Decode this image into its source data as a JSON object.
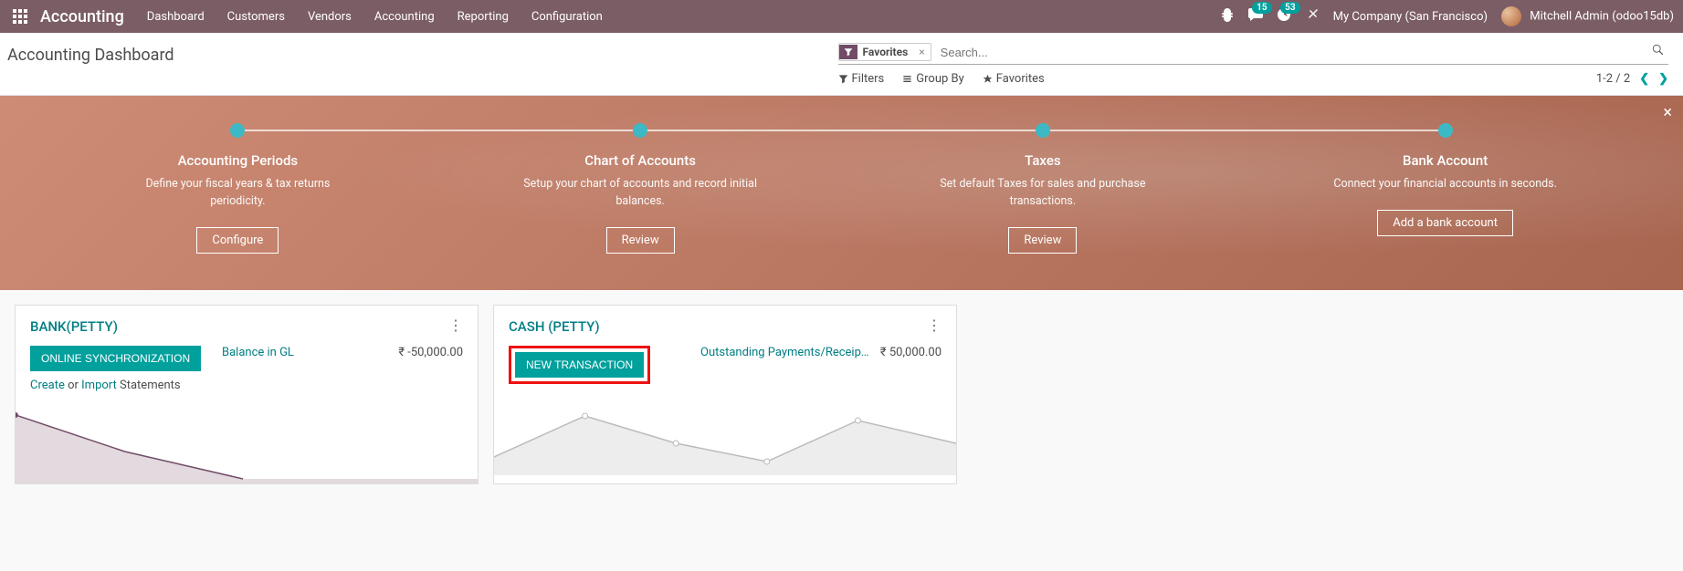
{
  "topnav": {
    "brand": "Accounting",
    "menu": [
      "Dashboard",
      "Customers",
      "Vendors",
      "Accounting",
      "Reporting",
      "Configuration"
    ],
    "messages_count": "15",
    "activities_count": "53",
    "company": "My Company (San Francisco)",
    "user": "Mitchell Admin (odoo15db)"
  },
  "breadcrumb": {
    "title": "Accounting Dashboard"
  },
  "search": {
    "facet_label": "Favorites",
    "placeholder": "Search...",
    "filters_label": "Filters",
    "groupby_label": "Group By",
    "favorites_label": "Favorites",
    "pager": "1-2 / 2"
  },
  "onboarding": {
    "steps": [
      {
        "title": "Accounting Periods",
        "desc": "Define your fiscal years & tax returns periodicity.",
        "btn": "Configure"
      },
      {
        "title": "Chart of Accounts",
        "desc": "Setup your chart of accounts and record initial balances.",
        "btn": "Review"
      },
      {
        "title": "Taxes",
        "desc": "Set default Taxes for sales and purchase transactions.",
        "btn": "Review"
      },
      {
        "title": "Bank Account",
        "desc": "Connect your financial accounts in seconds.",
        "btn": "Add a bank account"
      }
    ]
  },
  "cards": {
    "bank": {
      "title": "BANK(PETTY)",
      "primary_btn": "ONLINE SYNCHRONIZATION",
      "stat_label": "Balance in GL",
      "stat_value": "₹ -50,000.00",
      "sub_create": "Create",
      "sub_or": " or ",
      "sub_import": "Import",
      "sub_statements": " Statements"
    },
    "cash": {
      "title": "CASH (PETTY)",
      "primary_btn": "NEW TRANSACTION",
      "stat_label": "Outstanding Payments/Receip…",
      "stat_value": "₹ 50,000.00"
    }
  }
}
